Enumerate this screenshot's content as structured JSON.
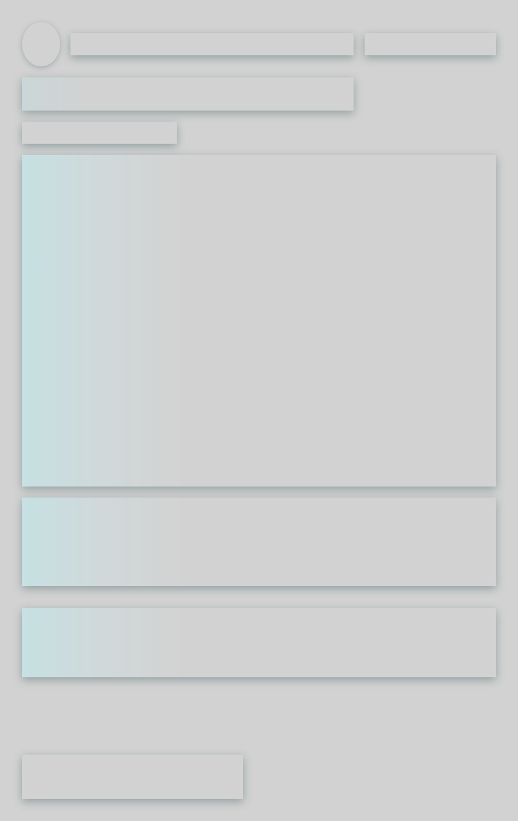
{
  "state": "loading",
  "colors": {
    "background": "#d2d2d2",
    "shimmer_highlight": "#c7e0e3",
    "placeholder_shadow": "#466464"
  },
  "skeleton": {
    "header": {
      "avatar": "avatar-placeholder",
      "name": "",
      "meta": ""
    },
    "title": "",
    "subtitle": "",
    "media": "",
    "body": [
      "",
      ""
    ],
    "action": ""
  }
}
